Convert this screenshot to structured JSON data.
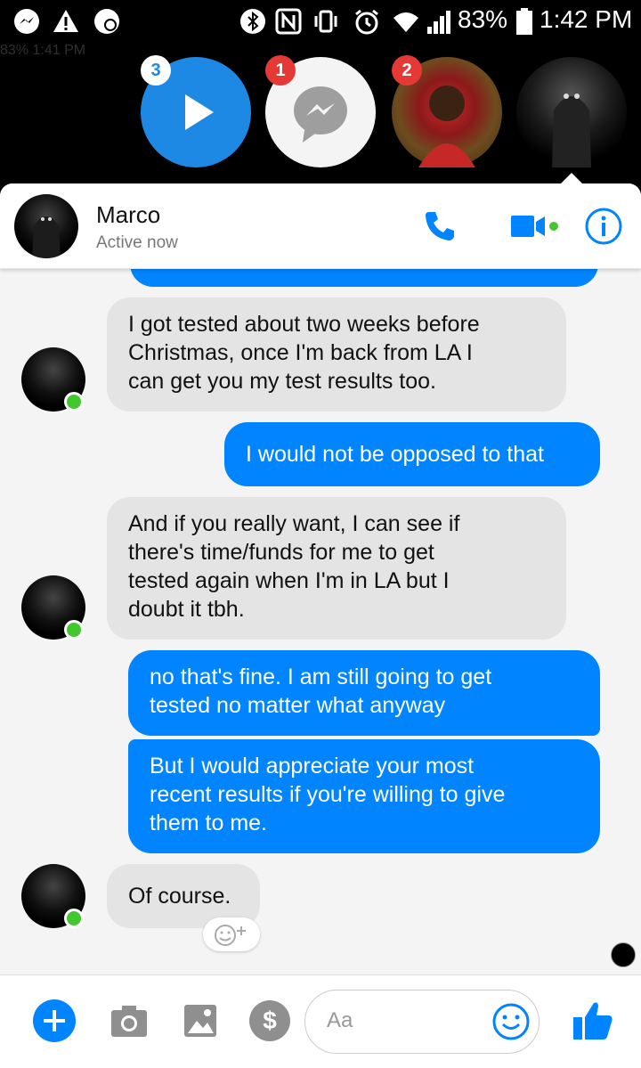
{
  "status_bar": {
    "battery": "83%",
    "time": "1:42 PM",
    "ghost_battery": "83%",
    "ghost_time": "1:41 PM"
  },
  "chat_heads": [
    {
      "name": "video-head",
      "badge": "3",
      "badge_color": "#1e88e5"
    },
    {
      "name": "messenger-head",
      "badge": "1",
      "badge_color": "#e53935"
    },
    {
      "name": "contact-head",
      "badge": "2",
      "badge_color": "#e53935"
    }
  ],
  "header": {
    "name": "Marco",
    "status": "Active now"
  },
  "messages": [
    {
      "dir": "in",
      "text_lines": [
        "I got tested about two weeks before",
        "Christmas, once I'm back from LA I",
        "can get you my test results too."
      ]
    },
    {
      "dir": "out",
      "text_lines": [
        "I would not be opposed to that"
      ]
    },
    {
      "dir": "in",
      "text_lines": [
        "And if you really want, I can see if",
        "there's time/funds for me to get",
        "tested again when I'm in LA but I",
        "doubt it tbh."
      ]
    },
    {
      "dir": "out",
      "text_lines": [
        "no that's fine. I am still going to get",
        "tested no matter what anyway"
      ]
    },
    {
      "dir": "out",
      "text_lines": [
        "But I would appreciate your most",
        "recent results if you're willing to give",
        "them to me."
      ]
    },
    {
      "dir": "in",
      "text_lines": [
        "Of course."
      ]
    }
  ],
  "composer": {
    "placeholder": "Aa"
  },
  "colors": {
    "accent": "#0084ff",
    "incoming_bubble": "#e4e4e4",
    "online": "#42c72f"
  }
}
